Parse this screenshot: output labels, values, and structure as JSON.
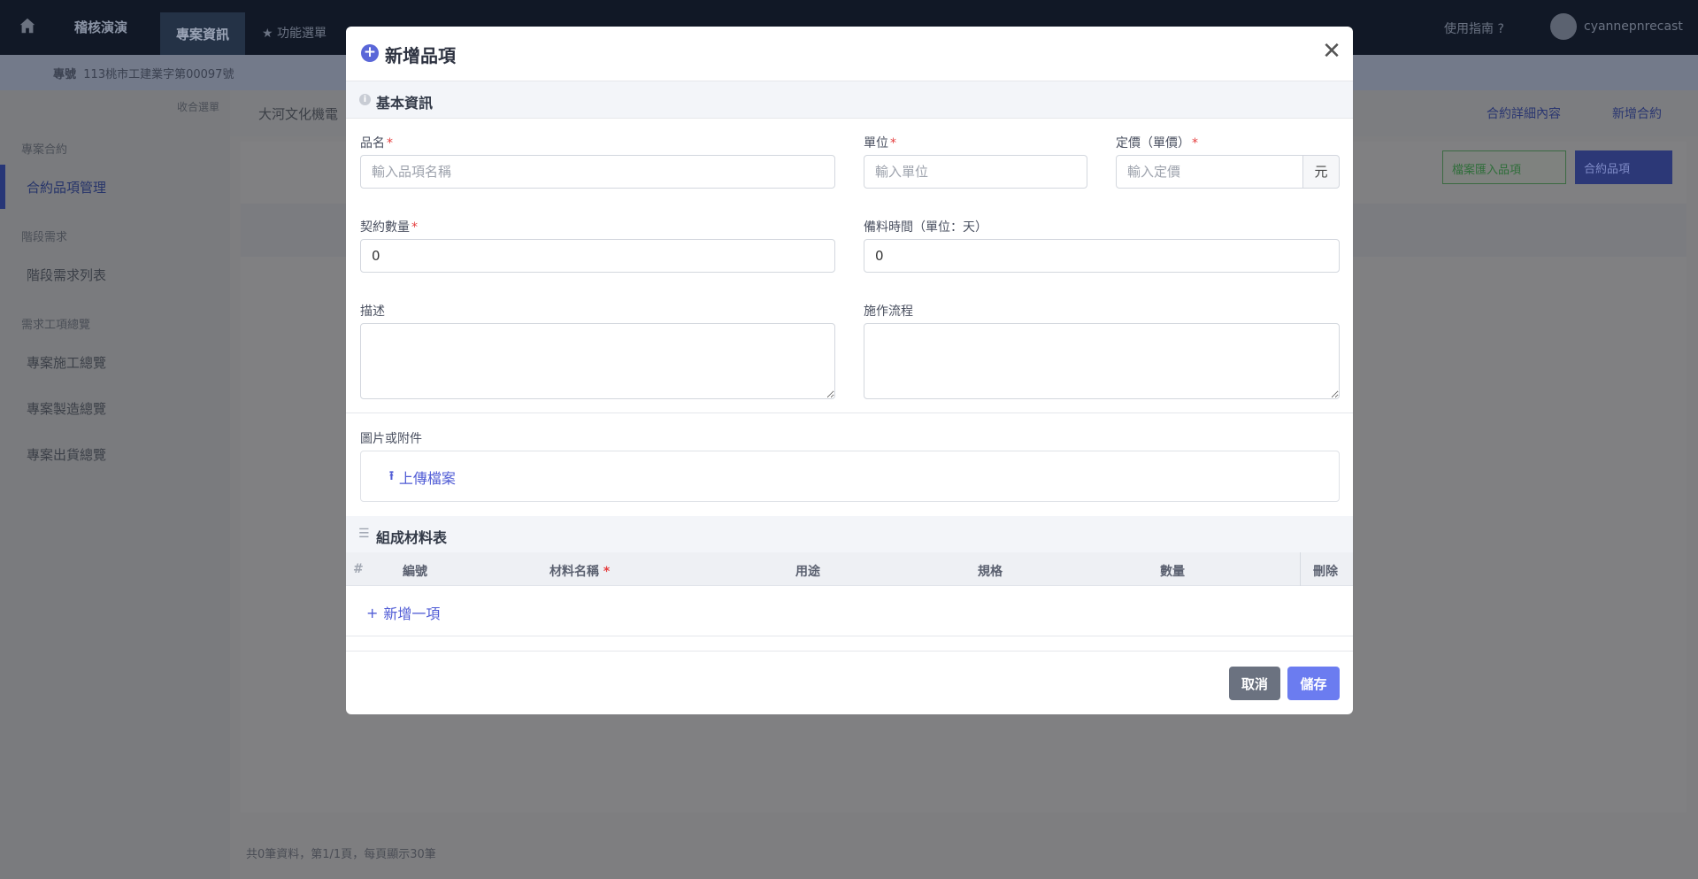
{
  "background": {
    "brand": "稽核演演",
    "nav_active_tab": "專案資訊",
    "nav_tab_func": "功能選單",
    "help_label": "使用指南",
    "username": "cyannepnrecast",
    "sub_label": "專號",
    "sub_value": "113桃市工建業字第00097號",
    "sidebar_collapse": "收合選單",
    "sidebar": [
      {
        "group": "專案合約",
        "items": [
          "合約品項管理"
        ]
      },
      {
        "group": "階段需求",
        "items": [
          "階段需求列表"
        ]
      },
      {
        "group": "需求工項總覽",
        "items": [
          "專案施工總覽",
          "專案製造總覽",
          "專案出貨總覽"
        ]
      }
    ],
    "breadcrumb": "大河文化機電",
    "link_contract_detail": "合約詳細內容",
    "link_new_contract": "新增合約",
    "btn_import": "檔案匯入品項",
    "btn_contract_items": "合約品項",
    "footer": "共0筆資料，第1/1頁，每頁顯示30筆"
  },
  "modal": {
    "title": "新增品項",
    "section_basic": "基本資訊",
    "fields": {
      "name": {
        "label": "品名",
        "placeholder": "輸入品項名稱",
        "required": true
      },
      "unit": {
        "label": "單位",
        "placeholder": "輸入單位",
        "required": true
      },
      "price": {
        "label": "定價（單價）",
        "placeholder": "輸入定價",
        "suffix": "元",
        "required": true
      },
      "qty": {
        "label": "契約數量",
        "value": "0",
        "required": true
      },
      "prep": {
        "label": "備料時間（單位：天）",
        "value": "0"
      },
      "desc": {
        "label": "描述"
      },
      "process": {
        "label": "施作流程"
      }
    },
    "attachments_label": "圖片或附件",
    "upload_label": "上傳檔案",
    "section_materials": "組成材料表",
    "material_columns": {
      "hash": "#",
      "number": "編號",
      "name": "材料名稱",
      "usage": "用途",
      "spec": "規格",
      "qty": "數量",
      "delete": "刪除"
    },
    "add_row_label": "新增一項",
    "cancel_label": "取消",
    "save_label": "儲存"
  }
}
